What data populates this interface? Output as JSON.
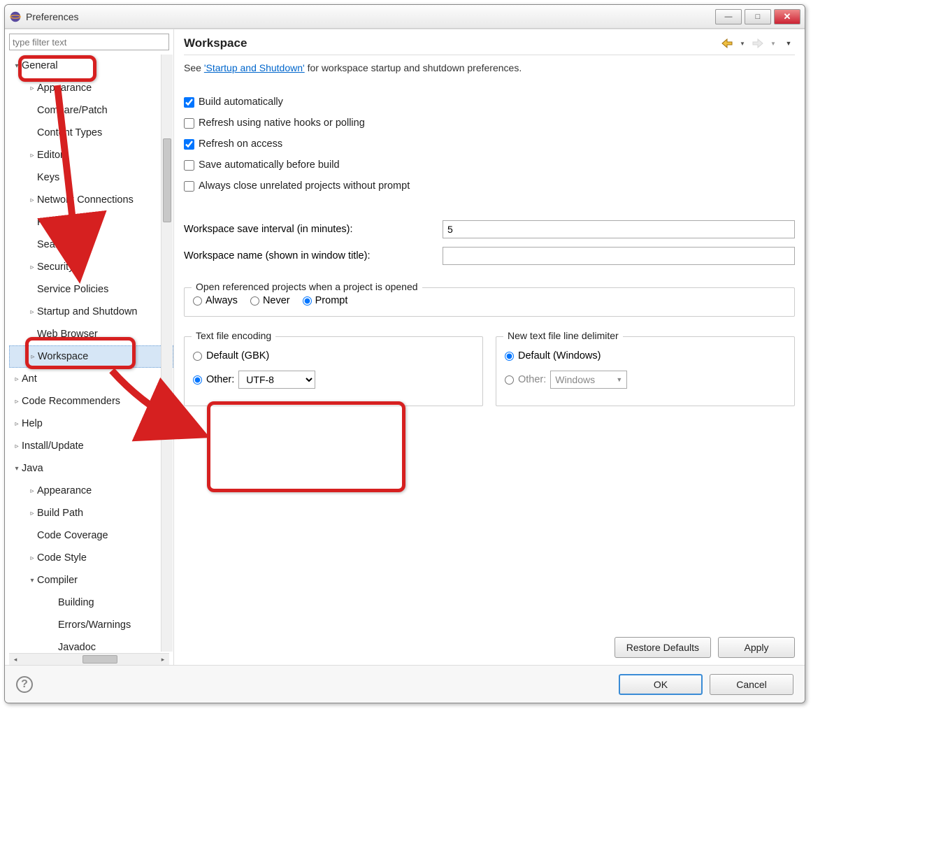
{
  "window": {
    "title": "Preferences",
    "buttons": {
      "min": "—",
      "max": "□",
      "close": "✕"
    }
  },
  "sidebar": {
    "filter_placeholder": "type filter text",
    "items": [
      {
        "label": "General",
        "level": 0,
        "tw": "▾",
        "expandable": true
      },
      {
        "label": "Appearance",
        "level": 1,
        "tw": "▹",
        "expandable": true
      },
      {
        "label": "Compare/Patch",
        "level": 1,
        "tw": "",
        "expandable": false
      },
      {
        "label": "Content Types",
        "level": 1,
        "tw": "",
        "expandable": false
      },
      {
        "label": "Editors",
        "level": 1,
        "tw": "▹",
        "expandable": true
      },
      {
        "label": "Keys",
        "level": 1,
        "tw": "",
        "expandable": false
      },
      {
        "label": "Network Connections",
        "level": 1,
        "tw": "▹",
        "expandable": true
      },
      {
        "label": "Perspectives",
        "level": 1,
        "tw": "",
        "expandable": false
      },
      {
        "label": "Search",
        "level": 1,
        "tw": "",
        "expandable": false
      },
      {
        "label": "Security",
        "level": 1,
        "tw": "▹",
        "expandable": true
      },
      {
        "label": "Service Policies",
        "level": 1,
        "tw": "",
        "expandable": false
      },
      {
        "label": "Startup and Shutdown",
        "level": 1,
        "tw": "▹",
        "expandable": true
      },
      {
        "label": "Web Browser",
        "level": 1,
        "tw": "",
        "expandable": false
      },
      {
        "label": "Workspace",
        "level": 1,
        "tw": "▹",
        "expandable": true,
        "selected": true
      },
      {
        "label": "Ant",
        "level": 0,
        "tw": "▹",
        "expandable": true
      },
      {
        "label": "Code Recommenders",
        "level": 0,
        "tw": "▹",
        "expandable": true
      },
      {
        "label": "Help",
        "level": 0,
        "tw": "▹",
        "expandable": true
      },
      {
        "label": "Install/Update",
        "level": 0,
        "tw": "▹",
        "expandable": true
      },
      {
        "label": "Java",
        "level": 0,
        "tw": "▾",
        "expandable": true
      },
      {
        "label": "Appearance",
        "level": 1,
        "tw": "▹",
        "expandable": true
      },
      {
        "label": "Build Path",
        "level": 1,
        "tw": "▹",
        "expandable": true
      },
      {
        "label": "Code Coverage",
        "level": 1,
        "tw": "",
        "expandable": false
      },
      {
        "label": "Code Style",
        "level": 1,
        "tw": "▹",
        "expandable": true
      },
      {
        "label": "Compiler",
        "level": 1,
        "tw": "▾",
        "expandable": true
      },
      {
        "label": "Building",
        "level": 2,
        "tw": "",
        "expandable": false
      },
      {
        "label": "Errors/Warnings",
        "level": 2,
        "tw": "",
        "expandable": false
      },
      {
        "label": "Javadoc",
        "level": 2,
        "tw": "",
        "expandable": false
      }
    ]
  },
  "page": {
    "title": "Workspace",
    "desc_prefix": "See ",
    "desc_link": "'Startup and Shutdown'",
    "desc_suffix": " for workspace startup and shutdown preferences.",
    "checks": {
      "build_auto": {
        "label": "Build automatically",
        "checked": true
      },
      "refresh_hooks": {
        "label": "Refresh using native hooks or polling",
        "checked": false
      },
      "refresh_access": {
        "label": "Refresh on access",
        "checked": true
      },
      "save_before_build": {
        "label": "Save automatically before build",
        "checked": false
      },
      "close_unrelated": {
        "label": "Always close unrelated projects without prompt",
        "checked": false
      }
    },
    "save_interval": {
      "label": "Workspace save interval (in minutes):",
      "value": "5"
    },
    "workspace_name": {
      "label": "Workspace name (shown in window title):",
      "value": ""
    },
    "open_ref": {
      "legend": "Open referenced projects when a project is opened",
      "always": "Always",
      "never": "Never",
      "prompt": "Prompt",
      "selected": "prompt"
    },
    "encoding": {
      "legend": "Text file encoding",
      "default_label": "Default (GBK)",
      "other_label": "Other:",
      "other_value": "UTF-8",
      "selected": "other"
    },
    "delimiter": {
      "legend": "New text file line delimiter",
      "default_label": "Default (Windows)",
      "other_label": "Other:",
      "other_value": "Windows",
      "selected": "default"
    },
    "buttons": {
      "restore": "Restore Defaults",
      "apply": "Apply"
    }
  },
  "footer": {
    "help": "?",
    "ok": "OK",
    "cancel": "Cancel"
  },
  "colors": {
    "annotation": "#d62020"
  }
}
